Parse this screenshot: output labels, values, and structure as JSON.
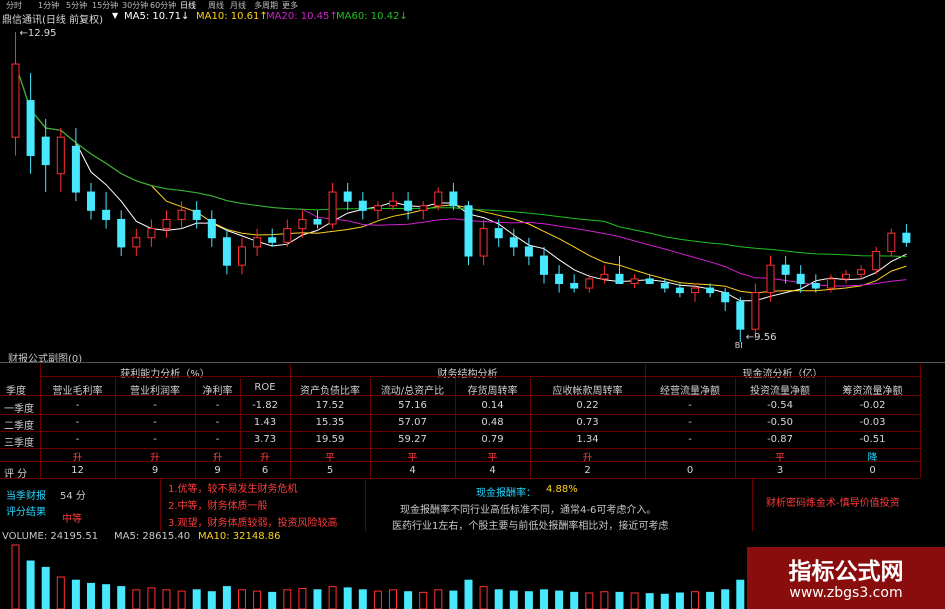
{
  "toolbar": {
    "items": [
      "分时",
      "1分钟",
      "5分钟",
      "15分钟",
      "30分钟",
      "60分钟",
      "日线",
      "周线",
      "月线",
      "多周期",
      "更多"
    ],
    "active_index": 6
  },
  "ma_legend": {
    "title": "鼎信通讯(日线 前复权)",
    "ma5": "MA5: 10.71↓",
    "ma10": "MA10: 10.61↑",
    "ma20": "MA20: 10.45↑",
    "ma60": "MA60: 10.42↓",
    "ma5_color": "#ffffff",
    "ma10_color": "#ffd21e",
    "ma20_color": "#d020d0",
    "ma60_color": "#20c020"
  },
  "price_chart": {
    "high_label": "12.95",
    "low_label": "9.56",
    "marker_label": "BI",
    "up_color": "#ff3030",
    "down_color": "#48e8ff",
    "candles": [
      [
        11.8,
        12.95,
        11.6,
        12.6
      ],
      [
        12.2,
        12.5,
        11.4,
        11.6
      ],
      [
        11.8,
        12.0,
        11.2,
        11.5
      ],
      [
        11.4,
        11.9,
        11.2,
        11.8
      ],
      [
        11.7,
        11.9,
        11.1,
        11.2
      ],
      [
        11.2,
        11.3,
        10.9,
        11.0
      ],
      [
        11.0,
        11.2,
        10.8,
        10.9
      ],
      [
        10.9,
        11.0,
        10.5,
        10.6
      ],
      [
        10.6,
        10.8,
        10.5,
        10.7
      ],
      [
        10.7,
        10.9,
        10.6,
        10.8
      ],
      [
        10.8,
        11.0,
        10.7,
        10.9
      ],
      [
        10.9,
        11.1,
        10.8,
        11.0
      ],
      [
        11.0,
        11.1,
        10.8,
        10.9
      ],
      [
        10.9,
        11.0,
        10.6,
        10.7
      ],
      [
        10.7,
        10.8,
        10.3,
        10.4
      ],
      [
        10.4,
        10.7,
        10.3,
        10.6
      ],
      [
        10.6,
        10.8,
        10.5,
        10.7
      ],
      [
        10.7,
        10.8,
        10.6,
        10.65
      ],
      [
        10.65,
        10.9,
        10.6,
        10.8
      ],
      [
        10.8,
        11.0,
        10.7,
        10.9
      ],
      [
        10.9,
        11.0,
        10.8,
        10.85
      ],
      [
        10.85,
        11.3,
        10.8,
        11.2
      ],
      [
        11.2,
        11.3,
        11.0,
        11.1
      ],
      [
        11.1,
        11.2,
        10.9,
        11.0
      ],
      [
        11.0,
        11.1,
        10.9,
        11.05
      ],
      [
        11.05,
        11.2,
        11.0,
        11.1
      ],
      [
        11.1,
        11.2,
        10.9,
        11.0
      ],
      [
        11.0,
        11.1,
        10.9,
        11.05
      ],
      [
        11.05,
        11.25,
        11.0,
        11.2
      ],
      [
        11.2,
        11.3,
        11.0,
        11.05
      ],
      [
        11.05,
        11.1,
        10.4,
        10.5
      ],
      [
        10.5,
        10.9,
        10.4,
        10.8
      ],
      [
        10.8,
        10.9,
        10.6,
        10.7
      ],
      [
        10.7,
        10.8,
        10.5,
        10.6
      ],
      [
        10.6,
        10.7,
        10.4,
        10.5
      ],
      [
        10.5,
        10.6,
        10.2,
        10.3
      ],
      [
        10.3,
        10.4,
        10.1,
        10.2
      ],
      [
        10.2,
        10.3,
        10.1,
        10.15
      ],
      [
        10.15,
        10.3,
        10.1,
        10.25
      ],
      [
        10.25,
        10.4,
        10.2,
        10.3
      ],
      [
        10.3,
        10.5,
        10.2,
        10.2
      ],
      [
        10.2,
        10.3,
        10.15,
        10.25
      ],
      [
        10.25,
        10.3,
        10.2,
        10.2
      ],
      [
        10.2,
        10.25,
        10.1,
        10.15
      ],
      [
        10.15,
        10.2,
        10.05,
        10.1
      ],
      [
        10.1,
        10.2,
        10.0,
        10.15
      ],
      [
        10.15,
        10.2,
        10.05,
        10.1
      ],
      [
        10.1,
        10.15,
        9.9,
        10.0
      ],
      [
        10.0,
        10.05,
        9.56,
        9.7
      ],
      [
        9.7,
        10.2,
        9.6,
        10.1
      ],
      [
        10.1,
        10.5,
        10.0,
        10.4
      ],
      [
        10.4,
        10.5,
        10.2,
        10.3
      ],
      [
        10.3,
        10.4,
        10.1,
        10.2
      ],
      [
        10.2,
        10.3,
        10.1,
        10.15
      ],
      [
        10.15,
        10.3,
        10.1,
        10.25
      ],
      [
        10.25,
        10.35,
        10.2,
        10.3
      ],
      [
        10.3,
        10.4,
        10.25,
        10.35
      ],
      [
        10.35,
        10.6,
        10.3,
        10.55
      ],
      [
        10.55,
        10.8,
        10.5,
        10.75
      ],
      [
        10.75,
        10.85,
        10.6,
        10.65
      ]
    ]
  },
  "fin_table": {
    "title": "财报公式副图(0)",
    "groups": [
      {
        "label": "获利能力分析（%）"
      },
      {
        "label": "财务结构分析"
      },
      {
        "label": "现金流分析（亿）"
      }
    ],
    "row_header": "季度",
    "columns": [
      "营业毛利率",
      "营业利润率",
      "净利率",
      "ROE",
      "资产负债比率",
      "流动/总资产比",
      "存货周转率",
      "应收帐款周转率",
      "经营流量净额",
      "投资流量净额",
      "筹资流量净额"
    ],
    "rows": [
      {
        "label": "一季度",
        "cells": [
          "-",
          "-",
          "-",
          "-1.82",
          "17.52",
          "57.16",
          "0.14",
          "0.22",
          "-",
          "-0.54",
          "-0.02"
        ]
      },
      {
        "label": "二季度",
        "cells": [
          "-",
          "-",
          "-",
          "1.43",
          "15.35",
          "57.07",
          "0.48",
          "0.73",
          "-",
          "-0.50",
          "-0.03"
        ]
      },
      {
        "label": "三季度",
        "cells": [
          "-",
          "-",
          "-",
          "3.73",
          "19.59",
          "59.27",
          "0.79",
          "1.34",
          "-",
          "-0.87",
          "-0.51"
        ]
      }
    ],
    "trend": [
      "升",
      "升",
      "升",
      "升",
      "平",
      "平",
      "平",
      "升",
      "",
      "平",
      "降"
    ],
    "score_label": "评  分",
    "scores": [
      "12",
      "9",
      "9",
      "6",
      "5",
      "4",
      "4",
      "2",
      "0",
      "3",
      "0"
    ],
    "summary": {
      "score_title": "当季财报",
      "score_value": "54 分",
      "result_title": "评分结果",
      "result_value": "中等",
      "notes": [
        "1.优等，较不易发生财务危机",
        "2.中等，财务体质一般",
        "3.观望，财务体质较弱，投资风险较高"
      ],
      "cash_title": "现金报酬率：",
      "cash_value": "4.88%",
      "cash_desc_1": "现金报酬率不同行业高低标准不同，通常4-6可考虑介入。",
      "cash_desc_2": "医药行业1左右，个股主要与前低处报酬率相比对，接近可考虑",
      "slogan": "财析密码炼金术-慎导价值投资"
    }
  },
  "volume": {
    "label": "VOLUME: 24195.51",
    "ma5": "MA5: 28615.40",
    "ma10": "MA10: 32148.86",
    "bars": [
      1.0,
      0.75,
      0.65,
      0.5,
      0.45,
      0.4,
      0.38,
      0.35,
      0.3,
      0.33,
      0.3,
      0.28,
      0.3,
      0.27,
      0.35,
      0.3,
      0.28,
      0.26,
      0.3,
      0.32,
      0.3,
      0.35,
      0.33,
      0.3,
      0.28,
      0.3,
      0.27,
      0.26,
      0.3,
      0.28,
      0.45,
      0.35,
      0.3,
      0.28,
      0.27,
      0.3,
      0.28,
      0.26,
      0.25,
      0.27,
      0.26,
      0.25,
      0.24,
      0.23,
      0.25,
      0.27,
      0.26,
      0.3,
      0.45,
      0.42,
      0.4,
      0.32,
      0.3,
      0.28,
      0.27,
      0.3,
      0.28,
      0.3,
      0.34,
      0.3
    ]
  },
  "watermark": {
    "title": "指标公式网",
    "url": "www.zbgs3.com"
  }
}
